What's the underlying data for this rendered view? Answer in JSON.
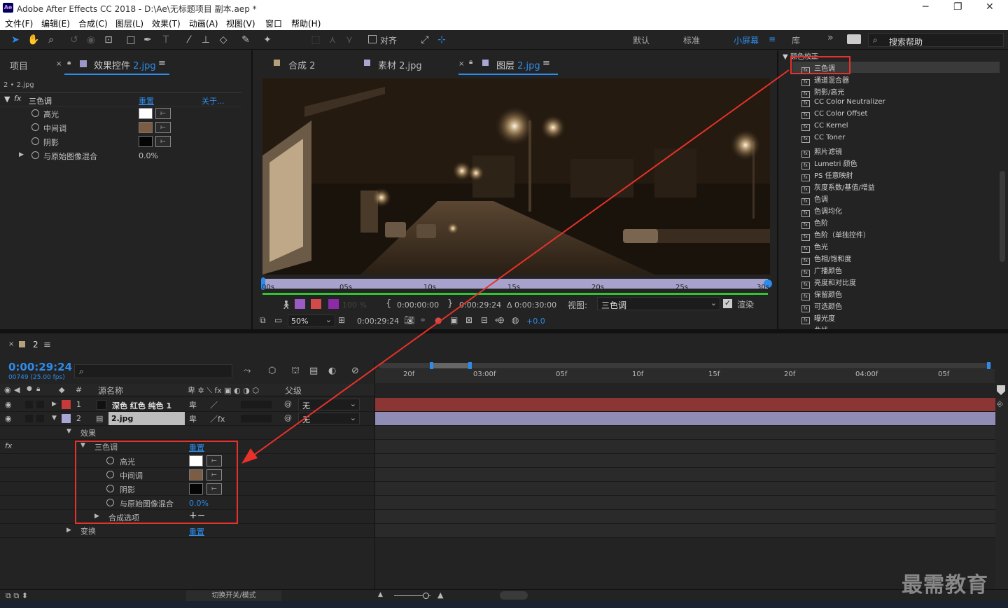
{
  "app": {
    "title": "Adobe After Effects CC 2018 - D:\\Ae\\无标题项目 副本.aep *",
    "logo": "Ae"
  },
  "menu": [
    "文件(F)",
    "编辑(E)",
    "合成(C)",
    "图层(L)",
    "效果(T)",
    "动画(A)",
    "视图(V)",
    "窗口",
    "帮助(H)"
  ],
  "toolbar": {
    "align": "对齐",
    "workspaces": [
      "默认",
      "标准",
      "小屏幕",
      "库"
    ],
    "search_placeholder": "搜索帮助",
    "chevrons": "»"
  },
  "left_panel": {
    "tab_project": "项目",
    "tab_effects": "效果控件",
    "tab_effects_file": "2.jpg",
    "layer_path": "2 • 2.jpg",
    "fx_label": "fx",
    "effect_name": "三色调",
    "reset": "重置",
    "about": "关于...",
    "props": [
      {
        "name": "高光"
      },
      {
        "name": "中间调"
      },
      {
        "name": "阴影"
      },
      {
        "name": "与原始图像混合",
        "value": "0.0%"
      }
    ]
  },
  "colors": {
    "highlight": "#ffffff",
    "midtone": "#7c5c42",
    "shadow": "#050505",
    "accent": "#2d8ceb",
    "annotation": "#e8312a"
  },
  "viewer": {
    "tabs": [
      {
        "label": "合成 2"
      },
      {
        "label": "素材 2.jpg"
      },
      {
        "label": "图层",
        "file": "2.jpg"
      }
    ],
    "ruler": [
      "00s",
      "05s",
      "10s",
      "15s",
      "20s",
      "25s",
      "30s"
    ],
    "opacity": "100 %",
    "time_in": "0:00:00:00",
    "time_out": "0:00:29:24",
    "duration": "Δ 0:00:30:00",
    "view_label": "视图:",
    "view_value": "三色调",
    "render_label": "渲染",
    "zoom": "50%",
    "current_time": "0:00:29:24",
    "exposure": "+0.0"
  },
  "effects_panel": {
    "category": "颜色校正",
    "items": [
      "三色调",
      "通道混合器",
      "阴影/高光",
      "CC Color Neutralizer",
      "CC Color Offset",
      "CC Kernel",
      "CC Toner",
      "照片滤镜",
      "Lumetri 颜色",
      "PS 任意映射",
      "灰度系数/基值/增益",
      "色调",
      "色调均化",
      "色阶",
      "色阶（单独控件）",
      "色光",
      "色相/饱和度",
      "广播颜色",
      "亮度和对比度",
      "保留颜色",
      "可选颜色",
      "曝光度",
      "曲线"
    ]
  },
  "timeline": {
    "comp_name": "2",
    "timecode": "0:00:29:24",
    "frames": "00749 (25.00 fps)",
    "search_placeholder": "",
    "ruler": [
      "20f",
      "03:00f",
      "05f",
      "10f",
      "15f",
      "20f",
      "04:00f",
      "05f"
    ],
    "col_num": "#",
    "col_source": "源名称",
    "col_parent": "父级",
    "layers": [
      {
        "num": "1",
        "name": "深色 红色 纯色 1",
        "parent": "无"
      },
      {
        "num": "2",
        "name": "2.jpg",
        "parent": "无"
      }
    ],
    "effects_group": "效果",
    "effect": "三色调",
    "reset": "重置",
    "props": [
      "高光",
      "中间调",
      "阴影",
      "与原始图像混合"
    ],
    "blend_value": "0.0%",
    "comp_options": "合成选项",
    "transform": "变换",
    "transform_reset": "重置",
    "footer_toggle": "切换开关/模式"
  },
  "watermark": "最需教育"
}
